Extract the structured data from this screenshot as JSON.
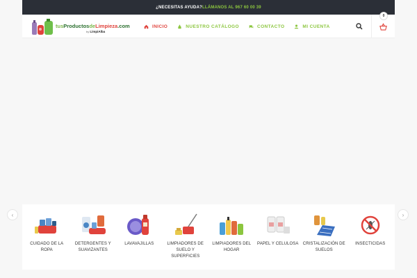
{
  "topbar": {
    "question": "¿NECESITAS AYUDA?",
    "phone": "LLÁMANOS AL 967 60 00 39"
  },
  "logo": {
    "part1": "tus",
    "part2": "Productos",
    "part3": "de",
    "part4": "Limpieza",
    "part5": ".com",
    "by": "by",
    "brand": "LimpiAlba"
  },
  "nav": [
    {
      "label": "INICIO",
      "icon": "house-icon"
    },
    {
      "label": "NUESTRO CATÁLOGO",
      "icon": "bottle-icon"
    },
    {
      "label": "CONTACTO",
      "icon": "chat-icon"
    },
    {
      "label": "MI CUENTA",
      "icon": "user-icon"
    }
  ],
  "cart": {
    "count": "0"
  },
  "categories": [
    {
      "label": "CUIDADO DE LA ROPA",
      "icon": "laundry-icon"
    },
    {
      "label": "DETERGENTES Y SUAVIZANTES",
      "icon": "detergent-icon"
    },
    {
      "label": "LAVAVAJILLAS",
      "icon": "dishwash-icon"
    },
    {
      "label": "LIMPIADORES DE SUELO Y SUPERFICIES",
      "icon": "mop-icon"
    },
    {
      "label": "LIMPIADORES DEL HOGAR",
      "icon": "home-cleaner-icon"
    },
    {
      "label": "PAPEL Y CELULOSA",
      "icon": "paper-roll-icon"
    },
    {
      "label": "CRISTALIZACIÓN DE SUELOS",
      "icon": "floor-crystal-icon"
    },
    {
      "label": "INSECTICIDAS",
      "icon": "insect-icon"
    }
  ],
  "colors": {
    "topbar": "#2b2f37",
    "accent_green": "#8cc63f",
    "accent_red": "#e0433c"
  }
}
